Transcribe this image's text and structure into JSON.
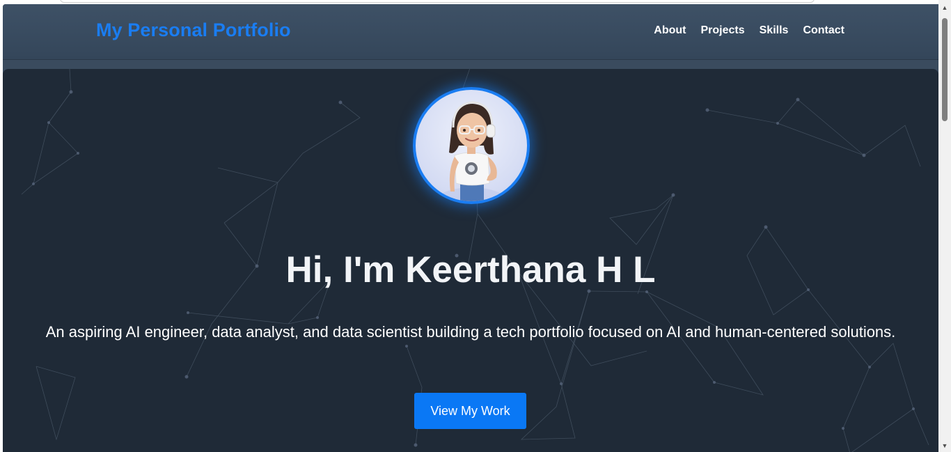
{
  "nav": {
    "brand": "My Personal Portfolio",
    "links": [
      "About",
      "Projects",
      "Skills",
      "Contact"
    ]
  },
  "hero": {
    "avatar_icon": "avatar-illustration",
    "title": "Hi, I'm Keerthana H L",
    "subtitle": "An aspiring AI engineer, data analyst, and data scientist building a tech portfolio focused on AI and human-centered solutions.",
    "cta_label": "View My Work"
  },
  "colors": {
    "accent": "#1a7df2",
    "button": "#0a78f5",
    "navbar_bg": "#3a4b5e",
    "hero_bg": "#1f2a37",
    "text": "#ffffff"
  },
  "scrollbar": {
    "up_icon": "chevron-up-icon",
    "down_icon": "chevron-down-icon"
  }
}
